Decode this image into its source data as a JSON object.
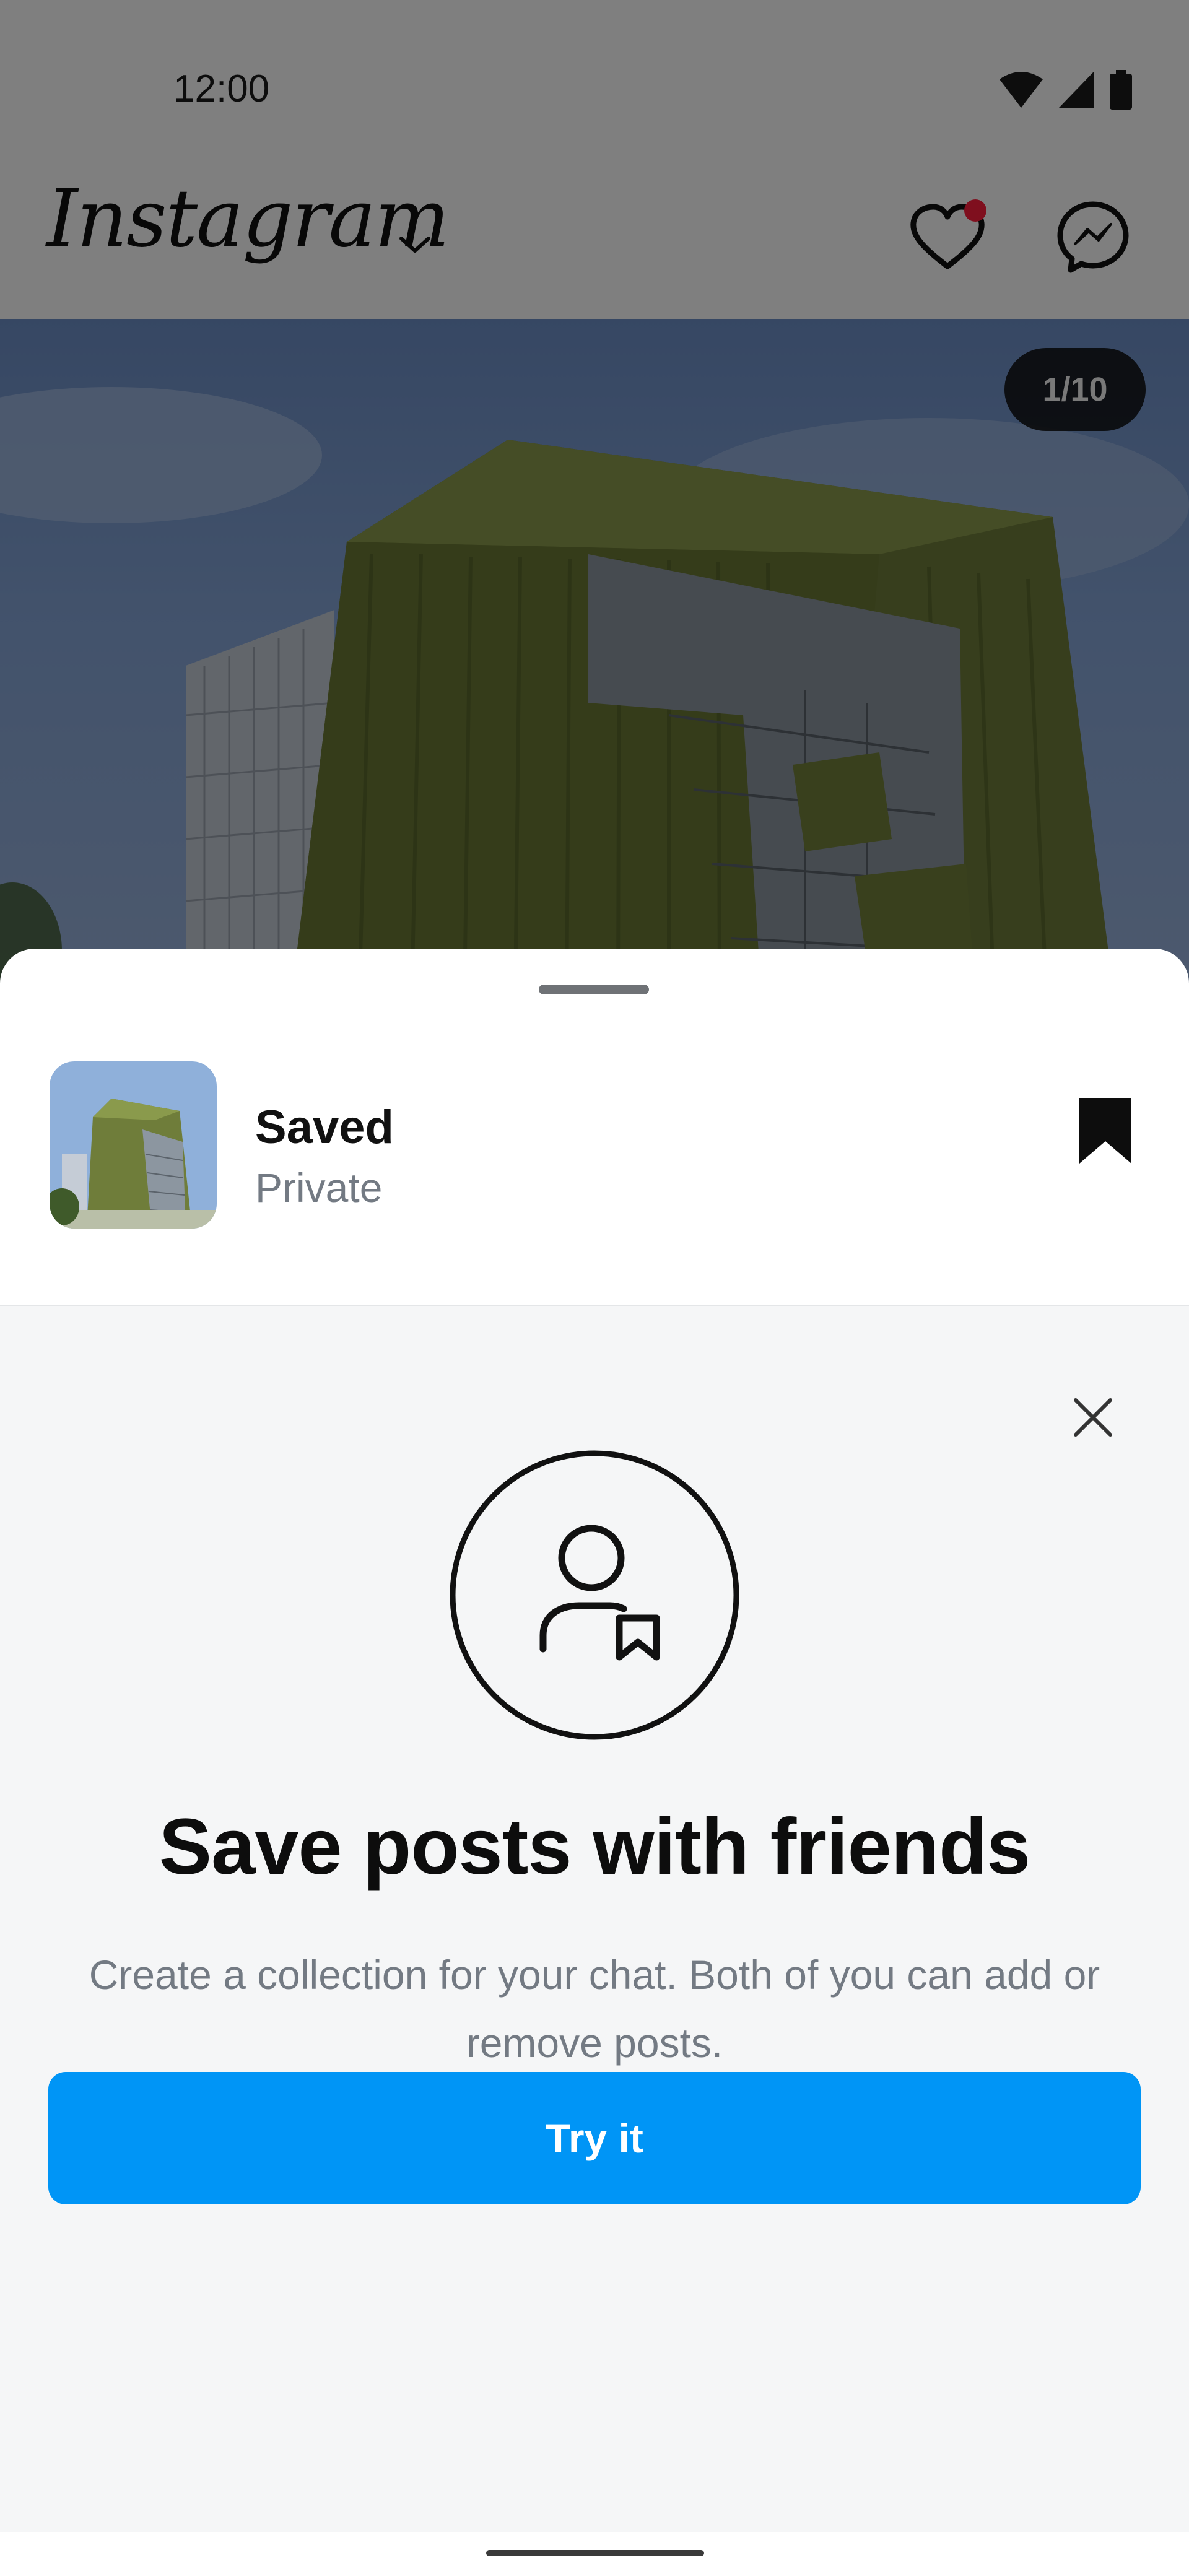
{
  "status_bar": {
    "time": "12:00"
  },
  "header": {
    "logo": "Instagram",
    "logo_menu_icon": "chevron-down-icon",
    "notifications_icon": "heart-icon",
    "messages_icon": "messenger-icon"
  },
  "post": {
    "counter": "1/10"
  },
  "sheet": {
    "collection": {
      "title": "Saved",
      "subtitle": "Private",
      "saved_icon": "bookmark-filled-icon"
    },
    "promo": {
      "close_icon": "close-icon",
      "illustration_icon": "person-bookmark-icon",
      "title": "Save posts with friends",
      "body": "Create a collection for your chat. Both of you can add or remove posts.",
      "button": "Try it"
    }
  },
  "colors": {
    "accent": "#0095f6",
    "notification_dot": "#ff1f3d",
    "promo_background": "#f5f6f7"
  }
}
